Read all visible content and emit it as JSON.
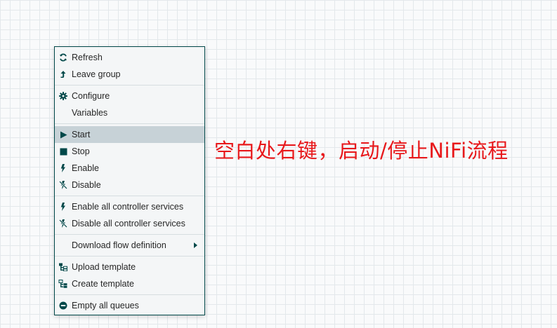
{
  "context_menu": {
    "refresh": "Refresh",
    "leave_group": "Leave group",
    "configure": "Configure",
    "variables": "Variables",
    "start": "Start",
    "stop": "Stop",
    "enable": "Enable",
    "disable": "Disable",
    "enable_all_controller_services": "Enable all controller services",
    "disable_all_controller_services": "Disable all controller services",
    "download_flow_definition": "Download flow definition",
    "upload_template": "Upload template",
    "create_template": "Create template",
    "empty_all_queues": "Empty all queues",
    "selected_item": "Start"
  },
  "annotation": {
    "text": "空白处右键，启动/停止NiFi流程",
    "color": "#e8181b"
  },
  "colors": {
    "icon": "#004849",
    "highlight": "#c7d2d7",
    "menu_background": "#f4f6f7"
  },
  "icons": {
    "refresh": "refresh-icon",
    "leave_group": "level-up-icon",
    "configure": "gear-icon",
    "start": "play-icon",
    "stop": "stop-square-icon",
    "enable": "flash-icon",
    "disable": "flash-disabled-icon",
    "upload_template": "upload-template-icon",
    "create_template": "create-template-icon",
    "empty_queues": "minus-circle-icon",
    "submenu": "caret-right-icon"
  }
}
